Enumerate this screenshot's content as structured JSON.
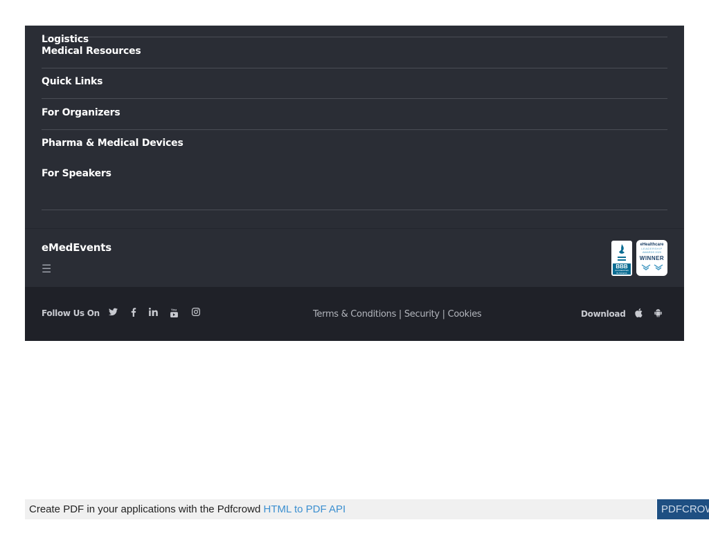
{
  "footer": {
    "links": [
      {
        "label": "Logistics"
      },
      {
        "label": "Medical Resources"
      },
      {
        "label": "Quick Links"
      },
      {
        "label": "For Organizers"
      },
      {
        "label": "Pharma & Medical Devices"
      },
      {
        "label": "For Speakers"
      }
    ],
    "brand": "eMedEvents",
    "menu_icon": "☰",
    "badges": {
      "bbb": {
        "name": "BBB",
        "caption": "ACCREDITED BUSINESS"
      },
      "award": {
        "line1": "eHealthcare",
        "line2": "LEADERSHIP",
        "line3": "AWARDS 2020",
        "line4": "WINNER"
      }
    }
  },
  "bottom_bar": {
    "follow_label": "Follow Us On",
    "social_icons": [
      "twitter-icon",
      "facebook-icon",
      "linkedin-icon",
      "youtube-icon",
      "instagram-icon"
    ],
    "legal": {
      "terms": "Terms & Conditions",
      "separator1": " | ",
      "security": "Security",
      "separator2": " | ",
      "cookies": "Cookies"
    },
    "download_label": "Download",
    "download_icons": [
      "apple-icon",
      "android-icon"
    ]
  },
  "pdf_banner": {
    "text": "Create PDF in your applications with the Pdfcrowd ",
    "link": "HTML to PDF API",
    "brand": "PDFCROWD"
  },
  "colors": {
    "footer_bg": "#2a2d35",
    "bottom_bar_bg": "#1f2128",
    "pdf_link": "#3b8fd0",
    "pdf_brand_bg": "#1e4f82"
  }
}
